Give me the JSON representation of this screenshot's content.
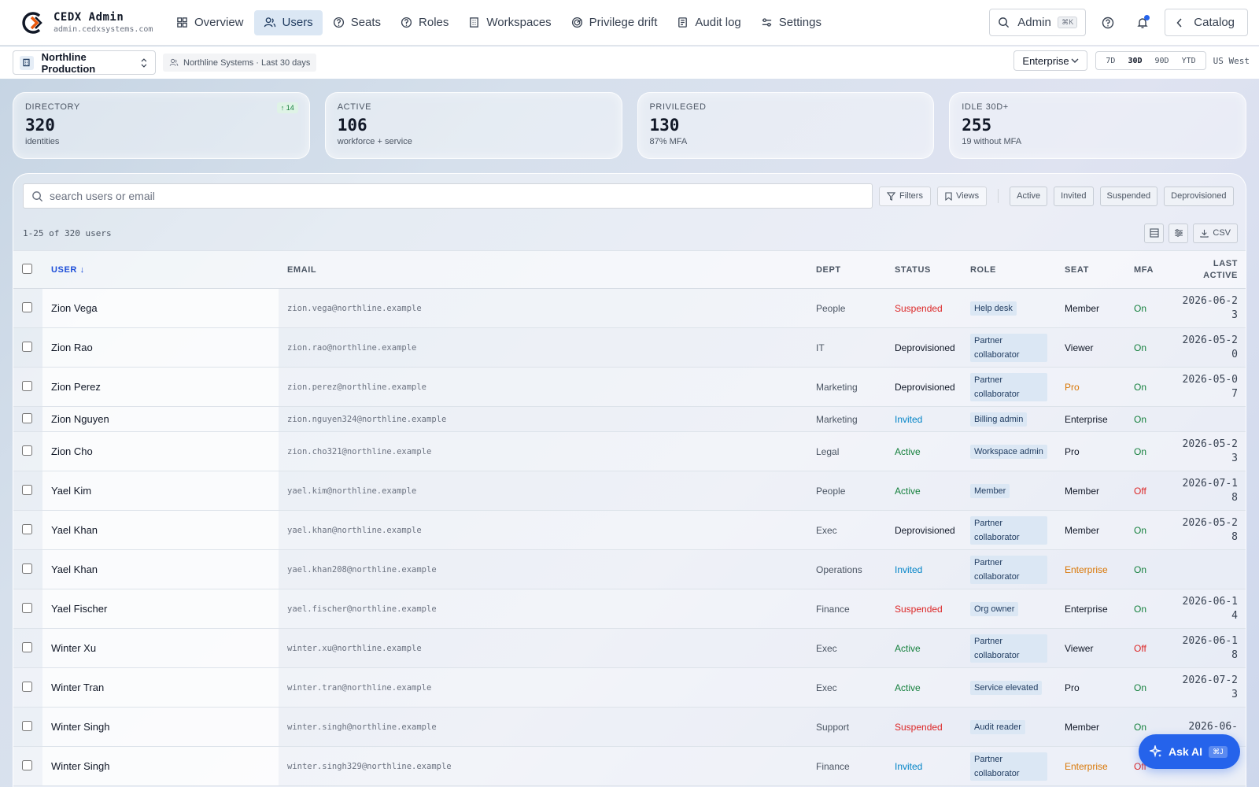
{
  "brand": {
    "title": "CEDX Admin",
    "subtitle": "admin.cedxsystems.com"
  },
  "nav": [
    {
      "label": "Overview",
      "icon": "grid-icon"
    },
    {
      "label": "Users",
      "icon": "users-icon",
      "active": true
    },
    {
      "label": "Seats",
      "icon": "seat-icon"
    },
    {
      "label": "Roles",
      "icon": "role-icon"
    },
    {
      "label": "Workspaces",
      "icon": "building-icon"
    },
    {
      "label": "Privilege drift",
      "icon": "drift-icon"
    },
    {
      "label": "Audit log",
      "icon": "scroll-icon"
    },
    {
      "label": "Settings",
      "icon": "sliders-icon"
    }
  ],
  "topbar": {
    "search_label": "Admin",
    "search_kbd": "⌘K",
    "catalog_label": "Catalog"
  },
  "subbar": {
    "workspace": "Northline Production",
    "org": "Northline Systems · Last 30 days",
    "plan": "Enterprise",
    "ranges": [
      "7D",
      "30D",
      "90D",
      "YTD"
    ],
    "active_range": "30D",
    "region": "US West"
  },
  "stats": [
    {
      "label": "DIRECTORY",
      "value": "320",
      "sub": "identities",
      "badge": "↑ 14"
    },
    {
      "label": "ACTIVE",
      "value": "106",
      "sub": "workforce + service"
    },
    {
      "label": "PRIVILEGED",
      "value": "130",
      "sub": "87% MFA"
    },
    {
      "label": "IDLE 30D+",
      "value": "255",
      "sub": "19 without MFA"
    }
  ],
  "toolbar": {
    "search_placeholder": "search users or email",
    "filters_label": "Filters",
    "views_label": "Views",
    "chips": [
      "Active",
      "Invited",
      "Suspended",
      "Deprovisioned"
    ]
  },
  "count_text": "1-25 of 320 users",
  "csv_label": "CSV",
  "columns": {
    "user": "USER ↓",
    "email": "EMAIL",
    "dept": "DEPT",
    "status": "STATUS",
    "role": "ROLE",
    "seat": "SEAT",
    "mfa": "MFA",
    "last_active": "LAST ACTIVE"
  },
  "rows": [
    {
      "user": "Zion Vega",
      "email": "zion.vega@northline.example",
      "dept": "People",
      "status": "Suspended",
      "role": "Help desk",
      "seat": "Member",
      "seat_warn": false,
      "mfa": "On",
      "last": "2026-06-23"
    },
    {
      "user": "Zion Rao",
      "email": "zion.rao@northline.example",
      "dept": "IT",
      "status": "Deprovisioned",
      "role": "Partner collaborator",
      "seat": "Viewer",
      "seat_warn": false,
      "mfa": "On",
      "last": "2026-05-20"
    },
    {
      "user": "Zion Perez",
      "email": "zion.perez@northline.example",
      "dept": "Marketing",
      "status": "Deprovisioned",
      "role": "Partner collaborator",
      "seat": "Pro",
      "seat_warn": true,
      "mfa": "On",
      "last": "2026-05-07"
    },
    {
      "user": "Zion Nguyen",
      "email": "zion.nguyen324@northline.example",
      "dept": "Marketing",
      "status": "Invited",
      "role": "Billing admin",
      "seat": "Enterprise",
      "seat_warn": false,
      "mfa": "On",
      "last": ""
    },
    {
      "user": "Zion Cho",
      "email": "zion.cho321@northline.example",
      "dept": "Legal",
      "status": "Active",
      "role": "Workspace admin",
      "seat": "Pro",
      "seat_warn": false,
      "mfa": "On",
      "last": "2026-05-23"
    },
    {
      "user": "Yael Kim",
      "email": "yael.kim@northline.example",
      "dept": "People",
      "status": "Active",
      "role": "Member",
      "seat": "Member",
      "seat_warn": false,
      "mfa": "Off",
      "last": "2026-07-18"
    },
    {
      "user": "Yael Khan",
      "email": "yael.khan@northline.example",
      "dept": "Exec",
      "status": "Deprovisioned",
      "role": "Partner collaborator",
      "seat": "Member",
      "seat_warn": false,
      "mfa": "On",
      "last": "2026-05-28"
    },
    {
      "user": "Yael Khan",
      "email": "yael.khan208@northline.example",
      "dept": "Operations",
      "status": "Invited",
      "role": "Partner collaborator",
      "seat": "Enterprise",
      "seat_warn": true,
      "mfa": "On",
      "last": ""
    },
    {
      "user": "Yael Fischer",
      "email": "yael.fischer@northline.example",
      "dept": "Finance",
      "status": "Suspended",
      "role": "Org owner",
      "seat": "Enterprise",
      "seat_warn": false,
      "mfa": "On",
      "last": "2026-06-14"
    },
    {
      "user": "Winter Xu",
      "email": "winter.xu@northline.example",
      "dept": "Exec",
      "status": "Active",
      "role": "Partner collaborator",
      "seat": "Viewer",
      "seat_warn": false,
      "mfa": "Off",
      "last": "2026-06-18"
    },
    {
      "user": "Winter Tran",
      "email": "winter.tran@northline.example",
      "dept": "Exec",
      "status": "Active",
      "role": "Service elevated",
      "seat": "Pro",
      "seat_warn": false,
      "mfa": "On",
      "last": "2026-07-23"
    },
    {
      "user": "Winter Singh",
      "email": "winter.singh@northline.example",
      "dept": "Support",
      "status": "Suspended",
      "role": "Audit reader",
      "seat": "Member",
      "seat_warn": false,
      "mfa": "On",
      "last": "2026-06-"
    },
    {
      "user": "Winter Singh",
      "email": "winter.singh329@northline.example",
      "dept": "Finance",
      "status": "Invited",
      "role": "Partner collaborator",
      "seat": "Enterprise",
      "seat_warn": true,
      "mfa": "Off",
      "last": ""
    }
  ],
  "ask_ai": {
    "label": "Ask AI",
    "kbd": "⌘J"
  }
}
